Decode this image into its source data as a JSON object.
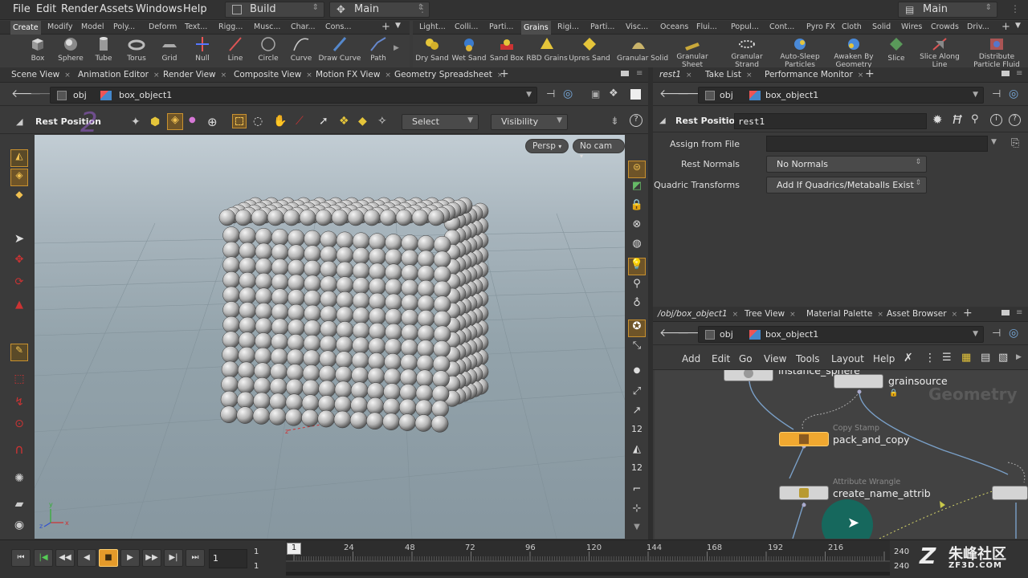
{
  "menubar": {
    "items": [
      "File",
      "Edit",
      "Render",
      "Assets",
      "Windows",
      "Help"
    ],
    "desktop": "Build",
    "context": "Main",
    "right_desktop": "Main"
  },
  "shelf_left": {
    "tabs": [
      "Create",
      "Modify",
      "Model",
      "Poly...",
      "Deform",
      "Text...",
      "Rigg...",
      "Musc...",
      "Char...",
      "Cons..."
    ],
    "tools": [
      "Box",
      "Sphere",
      "Tube",
      "Torus",
      "Grid",
      "Null",
      "Line",
      "Circle",
      "Curve",
      "Draw Curve",
      "Path"
    ]
  },
  "shelf_right": {
    "tabs": [
      "Light...",
      "Colli...",
      "Parti...",
      "Grains",
      "Rigi...",
      "Parti...",
      "Visc...",
      "Oceans",
      "Flui...",
      "Popul...",
      "Cont...",
      "Pyro FX",
      "Cloth",
      "Solid",
      "Wires",
      "Crowds",
      "Driv..."
    ],
    "tools": [
      "Dry Sand",
      "Wet Sand",
      "Sand Box",
      "RBD Grains",
      "Upres Sand",
      "Granular Solid",
      "Granular Sheet",
      "Granular Strand",
      "Auto-Sleep Particles",
      "Awaken By Geometry",
      "Slice",
      "Slice Along Line",
      "Distribute Particle Fluid"
    ]
  },
  "viewer_tabs": [
    "Scene View",
    "Animation Editor",
    "Render View",
    "Composite View",
    "Motion FX View",
    "Geometry Spreadsheet"
  ],
  "viewer_path": {
    "root": "obj",
    "object": "box_object1"
  },
  "operation": {
    "title": "Rest Position",
    "select_mode": "Select",
    "visibility": "Visibility"
  },
  "viewport": {
    "camera": "Persp",
    "cam": "No cam"
  },
  "param_tabs": [
    "rest1",
    "Take List",
    "Performance Monitor"
  ],
  "param_path": {
    "root": "obj",
    "object": "box_object1"
  },
  "node_params": {
    "type": "Rest Position",
    "name": "rest1",
    "rows": [
      {
        "label": "Assign from File",
        "value": ""
      },
      {
        "label": "Rest Normals",
        "value": "No Normals"
      },
      {
        "label": "Quadric Transforms",
        "value": "Add If Quadrics/Metaballs Exist"
      }
    ]
  },
  "network_tabs": [
    "/obj/box_object1",
    "Tree View",
    "Material Palette",
    "Asset Browser"
  ],
  "network_path": {
    "root": "obj",
    "object": "box_object1"
  },
  "network_menu": [
    "Add",
    "Edit",
    "Go",
    "View",
    "Tools",
    "Layout",
    "Help"
  ],
  "network": {
    "context_label": "Geometry",
    "nodes": [
      {
        "name": "instance_sphere",
        "type": ""
      },
      {
        "name": "grainsource",
        "type": ""
      },
      {
        "name": "pack_and_copy",
        "type": "Copy Stamp"
      },
      {
        "name": "create_name_attrib",
        "type": "Attribute Wrangle"
      }
    ]
  },
  "timeline": {
    "current_frame": "1",
    "start": "1",
    "start2": "1",
    "end": "240",
    "end2": "240",
    "ticks": [
      "24",
      "48",
      "72",
      "96",
      "120",
      "144",
      "168",
      "192",
      "216"
    ],
    "frame_marker": "1"
  },
  "watermark": {
    "text": "朱峰社区",
    "url_text": "ZF3D.COM"
  },
  "colors": {
    "accent_orange": "#f0a830",
    "teal_circle": "#0e6e62",
    "node_bg": "#d6d6d6"
  }
}
